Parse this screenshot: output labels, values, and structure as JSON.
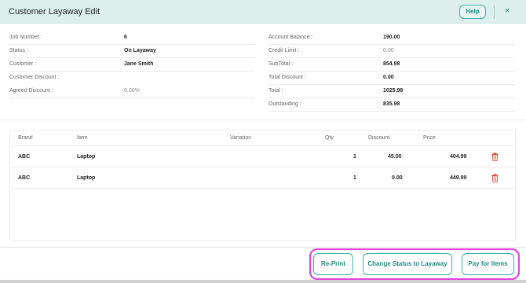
{
  "header": {
    "title": "Customer Layaway Edit",
    "help_label": "Help",
    "close_glyph": "×"
  },
  "left_info": [
    {
      "label": "Job Number :",
      "value": "6",
      "muted": false
    },
    {
      "label": "Status :",
      "value": "On Layaway",
      "muted": false
    },
    {
      "label": "Customer :",
      "value": "Jane Smith",
      "muted": false
    },
    {
      "label": "Customer Discount :",
      "value": "",
      "muted": false
    },
    {
      "label": "Agreed Discount :",
      "value": "0.00%",
      "muted": true
    }
  ],
  "right_info": [
    {
      "label": "Account Balance :",
      "value": "190.00",
      "muted": false
    },
    {
      "label": "Credit Limit :",
      "value": "0.00",
      "muted": true
    },
    {
      "label": "SubTotal :",
      "value": "854.98",
      "muted": false
    },
    {
      "label": "Total Discount :",
      "value": "0.00",
      "muted": false
    },
    {
      "label": "Total :",
      "value": "1025.98",
      "muted": false
    },
    {
      "label": "Outstanding :",
      "value": "835.98",
      "muted": false
    }
  ],
  "table": {
    "columns": [
      "Brand",
      "Item",
      "Variation",
      "Qty",
      "Discount",
      "Price"
    ],
    "rows": [
      {
        "brand": "ABC",
        "item": "Laptop",
        "variation": "",
        "qty": "1",
        "discount": "45.00",
        "price": "404.99"
      },
      {
        "brand": "ABC",
        "item": "Laptop",
        "variation": "",
        "qty": "1",
        "discount": "0.00",
        "price": "449.99"
      }
    ]
  },
  "footer": {
    "reprint_label": "Re-Print",
    "change_status_label": "Change Status to Layaway",
    "pay_label": "Pay for Items"
  },
  "colors": {
    "accent": "#1f8c80",
    "header_bg": "#dcefed",
    "highlight": "#e63ee0",
    "danger": "#e0493d"
  }
}
